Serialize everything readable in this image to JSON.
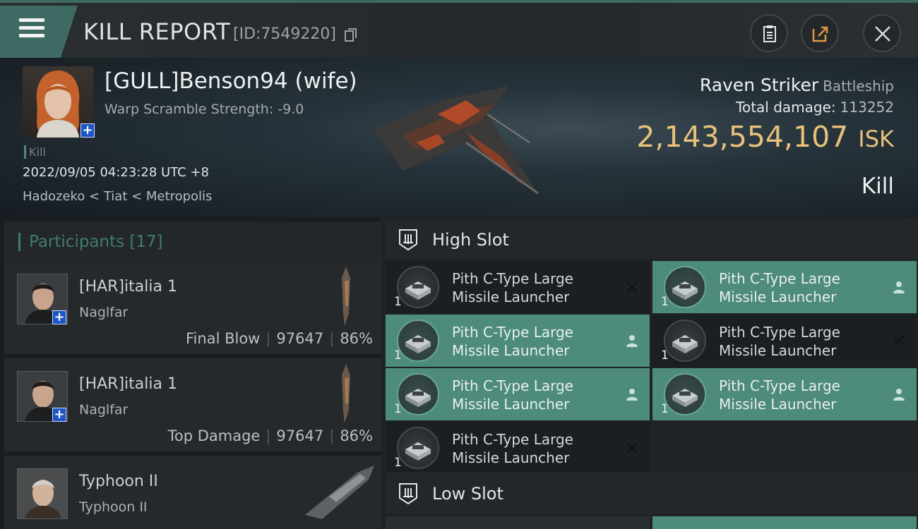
{
  "header": {
    "title": "KILL REPORT",
    "report_id": "[ID:7549220]",
    "icons": [
      "menu-icon",
      "copy-icon",
      "clipboard-icon",
      "share-icon",
      "close-icon"
    ]
  },
  "victim": {
    "name": "[GULL]Benson94 (wife)",
    "warp_scramble": "Warp Scramble Strength: -9.0",
    "tag": "Kill",
    "datetime": "2022/09/05 04:23:28 UTC +8",
    "location": "Hadozeko < Tiat < Metropolis",
    "plus_badge": "+"
  },
  "ship": {
    "name": "Raven Striker",
    "class": "Battleship",
    "total_damage_label": "Total damage:",
    "total_damage": "113252",
    "isk_value": "2,143,554,107",
    "isk_unit": "ISK",
    "result": "Kill"
  },
  "participants": {
    "label": "Participants",
    "count": "[17]",
    "rows": [
      {
        "name": "[HAR]italia 1",
        "ship": "Naglfar",
        "role": "Final Blow",
        "damage": "97647",
        "percent": "86%",
        "plus": "+"
      },
      {
        "name": "[HAR]italia 1",
        "ship": "Naglfar",
        "role": "Top Damage",
        "damage": "97647",
        "percent": "86%",
        "plus": "+"
      },
      {
        "name": "Typhoon II",
        "ship": "Typhoon II",
        "role": "",
        "damage": "",
        "percent": "",
        "plus": ""
      }
    ]
  },
  "slots": {
    "high": {
      "title": "High Slot",
      "modules": [
        {
          "name": "Pith C-Type Large Missile Launcher",
          "qty": "1",
          "status": "destroyed"
        },
        {
          "name": "Pith C-Type Large Missile Launcher",
          "qty": "1",
          "status": "dropped"
        },
        {
          "name": "Pith C-Type Large Missile Launcher",
          "qty": "1",
          "status": "dropped"
        },
        {
          "name": "Pith C-Type Large Missile Launcher",
          "qty": "1",
          "status": "destroyed"
        },
        {
          "name": "Pith C-Type Large Missile Launcher",
          "qty": "1",
          "status": "dropped"
        },
        {
          "name": "Pith C-Type Large Missile Launcher",
          "qty": "1",
          "status": "dropped"
        },
        {
          "name": "Pith C-Type Large Missile Launcher",
          "qty": "1",
          "status": "destroyed"
        }
      ]
    },
    "low": {
      "title": "Low Slot"
    }
  },
  "colors": {
    "accent": "#3d6a63",
    "dropped": "#4d8b7c",
    "isk": "#e7c17a",
    "participants_title": "#3f7c6f"
  }
}
